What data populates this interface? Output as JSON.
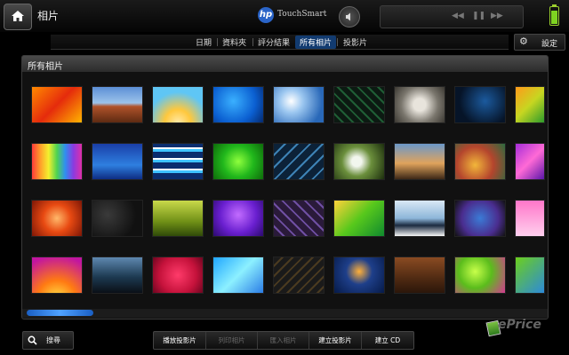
{
  "header": {
    "title": "相片",
    "brand": "TouchSmart",
    "logo_text": "hp"
  },
  "tabs": [
    {
      "label": "日期",
      "active": false
    },
    {
      "label": "資料夾",
      "active": false
    },
    {
      "label": "評分結果",
      "active": false
    },
    {
      "label": "所有相片",
      "active": true
    },
    {
      "label": "投影片",
      "active": false
    }
  ],
  "settings": {
    "label": "設定"
  },
  "panel": {
    "title": "所有相片"
  },
  "thumbnails": [
    {
      "bg": "linear-gradient(135deg,#ff8a00,#e52b0c,#ffb400)"
    },
    {
      "bg": "linear-gradient(#5c8fd6 0%,#9cc3ea 45%,#b0522a 55%,#5e2a12 100%)"
    },
    {
      "bg": "radial-gradient(circle at 50% 100%,#ffe9a6,#ffc83d 30%,#5fc6f5 70%)"
    },
    {
      "bg": "radial-gradient(circle at 40% 40%,#3ab0ff,#0b5fd1 60%,#052a6e)"
    },
    {
      "bg": "radial-gradient(circle at 35% 40%,#ffffff,#9cc7f0 30%,#2968b8 80%)"
    },
    {
      "bg": "repeating-linear-gradient(45deg,#0c1a12 0 6px,#1f5e35 6px 8px)"
    },
    {
      "bg": "radial-gradient(circle,#e8e4dc 20%,#7a766d 60%,#3b3832)"
    },
    {
      "bg": "radial-gradient(circle at 60% 40%,#1b5a9e,#061428 70%)"
    },
    {
      "bg": "linear-gradient(135deg,#ff9a1a,#c7d621,#2d9b2b)"
    },
    {
      "bg": "linear-gradient(90deg,#ff3a3a,#ff9e2a,#f4f02e,#4fd34f,#2f8ff0,#8b3ae0,#e02fa8)"
    },
    {
      "bg": "linear-gradient(#1a3fa8,#2e7fe0 60%,#0e2c82)"
    },
    {
      "bg": "repeating-linear-gradient(0deg,#0a2d6e 0 7px,#3ec3ff 7px 10px,#ffffff 10px 12px)"
    },
    {
      "bg": "radial-gradient(circle at 50% 50%,#8fff3d,#21b81c 50%,#0e6b0a)"
    },
    {
      "bg": "repeating-linear-gradient(135deg,#0c2238 0 8px,#3d82b4 8px 10px)"
    },
    {
      "bg": "radial-gradient(circle at 45% 50%,#f2f6ee 15%,#6b8f3c 45%,#1c2e0d)"
    },
    {
      "bg": "linear-gradient(#6b98c9,#e0a35c 55%,#3b2716)"
    },
    {
      "bg": "radial-gradient(circle at 40% 60%,#f2b63a,#b4452d 50%,#2a6b3f)"
    },
    {
      "bg": "linear-gradient(135deg,#a52dd8,#ff6ad6,#5a16a8)"
    },
    {
      "bg": "radial-gradient(circle,#ffb86a,#e84a12 45%,#7d1606)"
    },
    {
      "bg": "radial-gradient(circle at 30% 40%,#3a3a3a,#111 70%)"
    },
    {
      "bg": "linear-gradient(#c9d94a,#6f8f16 60%,#2f4a09)"
    },
    {
      "bg": "radial-gradient(circle at 50% 40%,#c26cff,#6a1fd0 55%,#2b0a6e)"
    },
    {
      "bg": "repeating-linear-gradient(45deg,#2a1a3a 0 7px,#6f4fa3 7px 9px)"
    },
    {
      "bg": "linear-gradient(135deg,#ffd23a,#57c81c 50%,#0f8a2e)"
    },
    {
      "bg": "linear-gradient(#d9e8f5,#8db6d9 50%,#1b2a3f 70%,#f5f5f5)"
    },
    {
      "bg": "radial-gradient(circle at 50% 50%,#3b7bd6,#4a2d8f 60%,#111)"
    },
    {
      "bg": "linear-gradient(#ff76c9,#ffd0ee)"
    },
    {
      "bg": "radial-gradient(circle at 50% 120%,#ffe94a,#ff7a12 40%,#c215a0 90%)"
    },
    {
      "bg": "linear-gradient(#5e88b0,#1d3a52 55%,#0a0f16)"
    },
    {
      "bg": "radial-gradient(circle,#ff3b6a,#c5123b 60%,#6e0520)"
    },
    {
      "bg": "linear-gradient(135deg,#1fa6ff,#8cf0ff,#2b7de6)"
    },
    {
      "bg": "repeating-linear-gradient(135deg,#1a1a1a 0 6px,#4a3a20 6px 8px)"
    },
    {
      "bg": "radial-gradient(circle at 50% 40%,#ffb03a,#1e3f8a 40%,#061a48)"
    },
    {
      "bg": "linear-gradient(#8a4b22,#4f2a12 60%,#2b160a)"
    },
    {
      "bg": "radial-gradient(circle at 40% 40%,#c8ff4a,#5bbd1c 45%,#d43a91)"
    },
    {
      "bg": "linear-gradient(135deg,#6ccf1c,#2d8ad9)"
    }
  ],
  "search": {
    "label": "搜尋"
  },
  "actions": [
    {
      "label": "播放投影片",
      "enabled": true
    },
    {
      "label": "列印相片",
      "enabled": false
    },
    {
      "label": "匯入相片",
      "enabled": false
    },
    {
      "label": "建立投影片",
      "enabled": true
    },
    {
      "label": "建立 CD",
      "enabled": true
    }
  ],
  "watermark": "ePrice",
  "icons": [
    "home-icon",
    "volume-icon",
    "rewind-icon",
    "pause-icon",
    "fast-forward-icon",
    "battery-icon",
    "gear-icon",
    "search-icon"
  ]
}
